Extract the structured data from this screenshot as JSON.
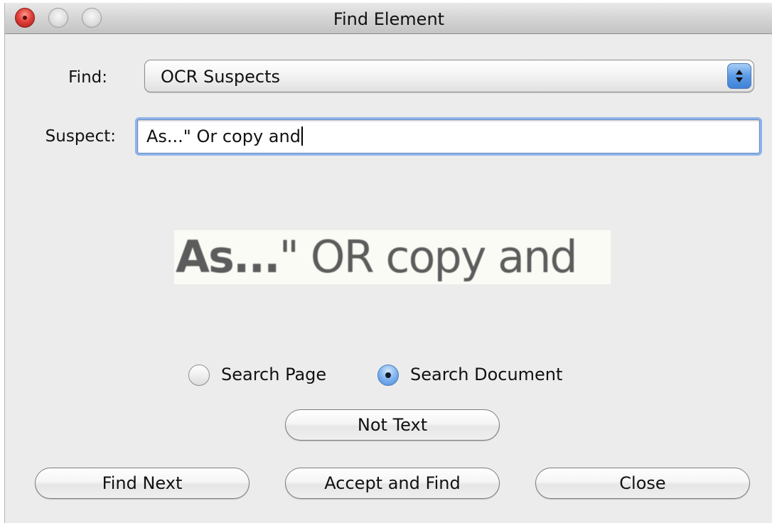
{
  "window": {
    "title": "Find Element"
  },
  "find": {
    "label": "Find:",
    "selected": "OCR Suspects"
  },
  "suspect": {
    "label": "Suspect:",
    "value": "As...\" Or copy and"
  },
  "preview": {
    "text": "As...\" OR copy and"
  },
  "scope": {
    "options": [
      {
        "label": "Search Page",
        "selected": false
      },
      {
        "label": "Search Document",
        "selected": true
      }
    ]
  },
  "buttons": {
    "not_text": "Not Text",
    "find_next": "Find Next",
    "accept_and_find": "Accept and Find",
    "close": "Close"
  }
}
